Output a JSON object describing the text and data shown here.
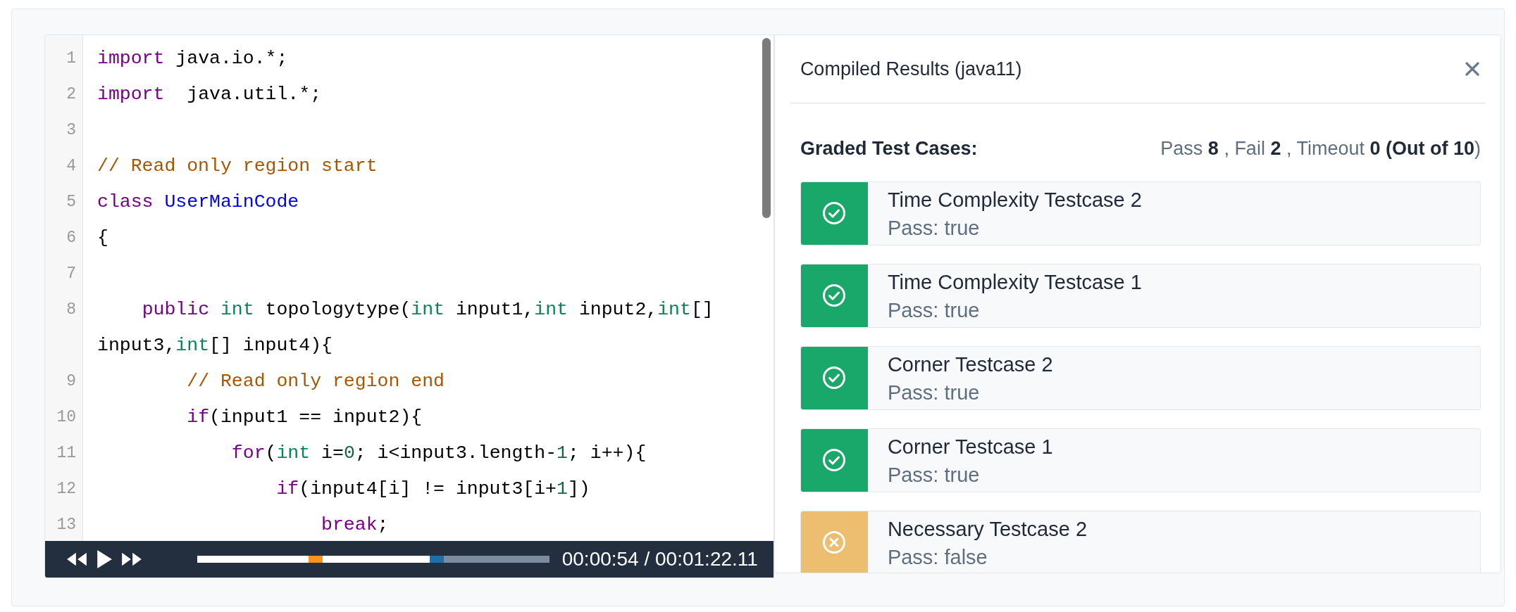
{
  "editor": {
    "lines": [
      {
        "number": "1",
        "tokens": [
          {
            "kind": "keyword",
            "text": "import"
          },
          {
            "kind": "plain",
            "text": " java.io.*;"
          }
        ]
      },
      {
        "number": "2",
        "tokens": [
          {
            "kind": "keyword",
            "text": "import"
          },
          {
            "kind": "plain",
            "text": "  java.util.*;"
          }
        ]
      },
      {
        "number": "3"
      },
      {
        "number": "4",
        "tokens": [
          {
            "kind": "comment",
            "text": "// Read only region start"
          }
        ]
      },
      {
        "number": "5",
        "tokens": [
          {
            "kind": "keyword",
            "text": "class "
          },
          {
            "kind": "classname",
            "text": "UserMainCode"
          }
        ]
      },
      {
        "number": "6",
        "tokens": [
          {
            "kind": "plain",
            "text": "{"
          }
        ]
      },
      {
        "number": "7"
      },
      {
        "number": "8",
        "tokens": [
          {
            "kind": "keyword",
            "text": "    public "
          },
          {
            "kind": "type",
            "text": "int"
          },
          {
            "kind": "plain",
            "text": " topologytype("
          },
          {
            "kind": "type",
            "text": "int"
          },
          {
            "kind": "plain",
            "text": " input1,"
          },
          {
            "kind": "type",
            "text": "int"
          },
          {
            "kind": "plain",
            "text": " input2,"
          },
          {
            "kind": "type",
            "text": "int"
          },
          {
            "kind": "plain",
            "text": "[] input3,"
          },
          {
            "kind": "type",
            "text": "int"
          },
          {
            "kind": "plain",
            "text": "[] input4){"
          }
        ]
      },
      {
        "number": "9",
        "tokens": [
          {
            "kind": "comment",
            "text": "        // Read only region end"
          }
        ]
      },
      {
        "number": "10",
        "tokens": [
          {
            "kind": "keyword",
            "text": "        if"
          },
          {
            "kind": "plain",
            "text": "(input1 == input2){"
          }
        ]
      },
      {
        "number": "11",
        "tokens": [
          {
            "kind": "keyword",
            "text": "            for"
          },
          {
            "kind": "plain",
            "text": "("
          },
          {
            "kind": "type",
            "text": "int"
          },
          {
            "kind": "plain",
            "text": " i="
          },
          {
            "kind": "number",
            "text": "0"
          },
          {
            "kind": "plain",
            "text": "; i<input3.length-"
          },
          {
            "kind": "number",
            "text": "1"
          },
          {
            "kind": "plain",
            "text": "; i++){"
          }
        ]
      },
      {
        "number": "12",
        "tokens": [
          {
            "kind": "keyword",
            "text": "                if"
          },
          {
            "kind": "plain",
            "text": "(input4[i] != input3[i+"
          },
          {
            "kind": "number",
            "text": "1"
          },
          {
            "kind": "plain",
            "text": "])"
          }
        ]
      },
      {
        "number": "13",
        "tokens": [
          {
            "kind": "keyword",
            "text": "                    break"
          },
          {
            "kind": "plain",
            "text": ";"
          }
        ]
      }
    ]
  },
  "player": {
    "level": 0.66,
    "time": "00:00:54 / 00:01:22.11"
  },
  "results": {
    "title": "Compiled Results (java11)",
    "section_label": "Graded Test Cases:",
    "summary": "Pass **8** , Fail **2** , Timeout **0 (Out of 10**)",
    "testcases": [
      {
        "name": "Time Complexity Testcase 2",
        "detail": "Pass: true",
        "passed": true
      },
      {
        "name": "Time Complexity Testcase 1",
        "detail": "Pass: true",
        "passed": true
      },
      {
        "name": "Corner Testcase 2",
        "detail": "Pass: true",
        "passed": true
      },
      {
        "name": "Corner Testcase 1",
        "detail": "Pass: true",
        "passed": true
      },
      {
        "name": "Necessary Testcase 2",
        "detail": "Pass: false",
        "passed": false
      }
    ]
  }
}
